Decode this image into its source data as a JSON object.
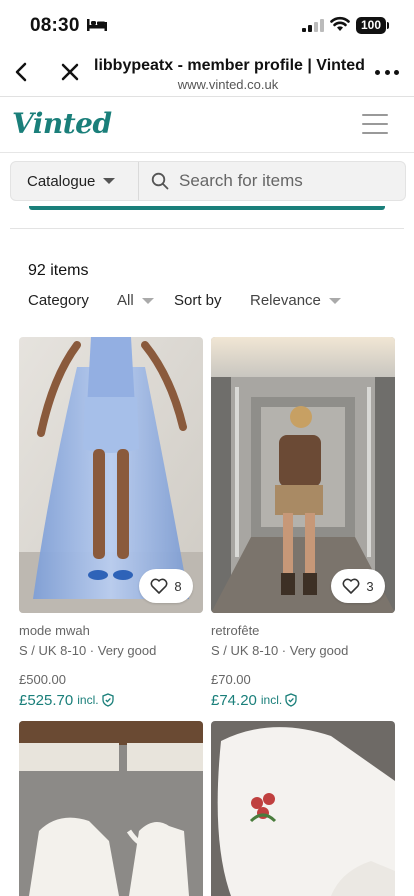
{
  "status_bar": {
    "time": "08:30",
    "battery": "100"
  },
  "browser": {
    "title": "libbypeatx - member profile | Vinted",
    "url": "www.vinted.co.uk"
  },
  "site": {
    "logo": "Vinted"
  },
  "search": {
    "catalogue_label": "Catalogue",
    "placeholder": "Search for items"
  },
  "listing": {
    "item_count": "92 items",
    "category_label": "Category",
    "category_value": "All",
    "sort_label": "Sort by",
    "sort_value": "Relevance"
  },
  "items": [
    {
      "brand": "mode mwah",
      "size_condition": "S / UK 8-10 · Very good",
      "price": "£500.00",
      "total": "£525.70",
      "incl": "incl.",
      "favourites": "8"
    },
    {
      "brand": "retrofête",
      "size_condition": "S / UK 8-10 · Very good",
      "price": "£70.00",
      "total": "£74.20",
      "incl": "incl.",
      "favourites": "3"
    }
  ],
  "icons": {
    "back": "chevron-left-icon",
    "close": "close-icon",
    "more": "ellipsis-icon",
    "menu": "hamburger-icon",
    "search": "search-icon",
    "favourite": "heart-icon",
    "buyer_protection": "shield-check-icon"
  },
  "colors": {
    "brand": "#1a7f7a",
    "text": "#111111",
    "muted": "#666666"
  }
}
